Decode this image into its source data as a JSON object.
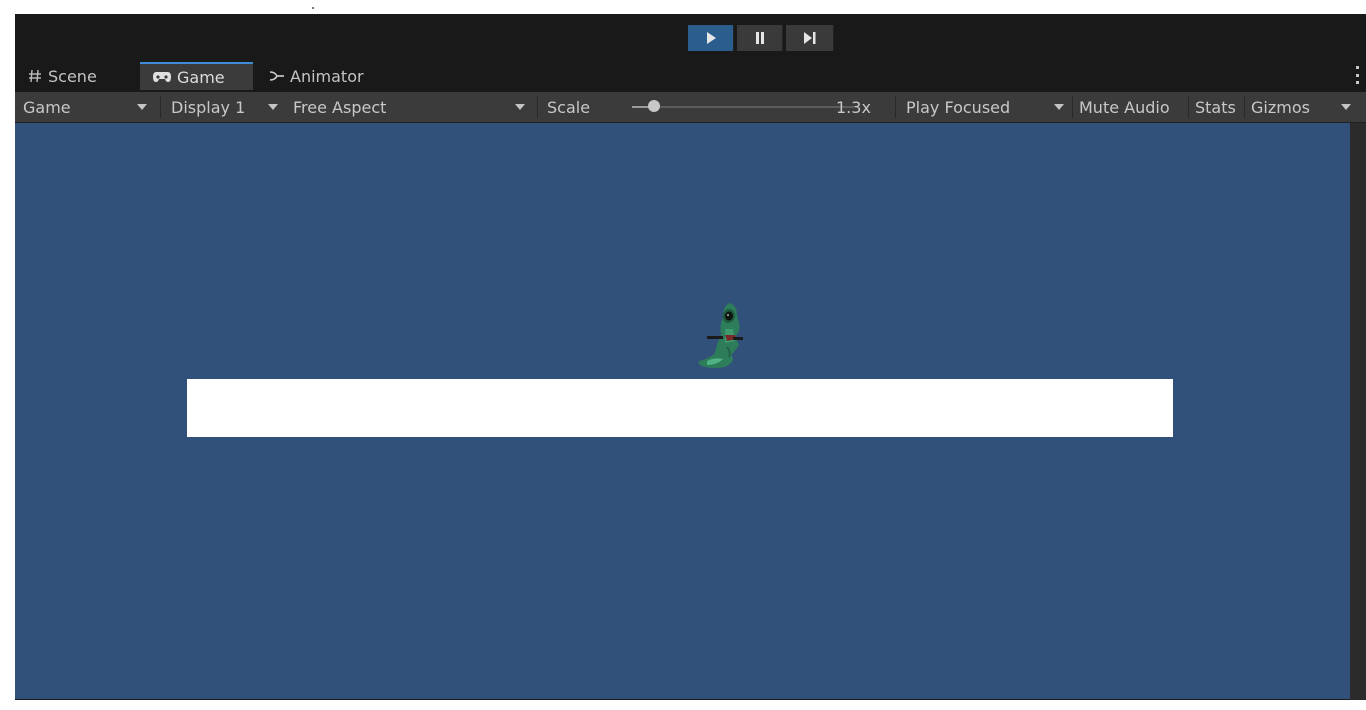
{
  "play_controls": {
    "play_icon": "play-icon",
    "pause_icon": "pause-icon",
    "step_icon": "step-forward-icon",
    "active_color": "#2b5d8d"
  },
  "tabs": [
    {
      "label": "Scene",
      "icon": "grid-hash-icon"
    },
    {
      "label": "Game",
      "icon": "gamepad-icon",
      "active": true
    },
    {
      "label": "Animator",
      "icon": "animator-branch-icon"
    }
  ],
  "toolbar": {
    "view_dropdown": "Game",
    "display_dropdown": "Display 1",
    "aspect_dropdown": "Free Aspect",
    "scale_label": "Scale",
    "scale_value": "1.3x",
    "scale_level": 0.1,
    "play_mode_dropdown": "Play Focused",
    "mute_audio": "Mute Audio",
    "stats": "Stats",
    "gizmos": "Gizmos"
  },
  "viewport": {
    "background": "#31507a",
    "platform_color": "#ffffff",
    "character": "hooded-ghost-sprite"
  }
}
